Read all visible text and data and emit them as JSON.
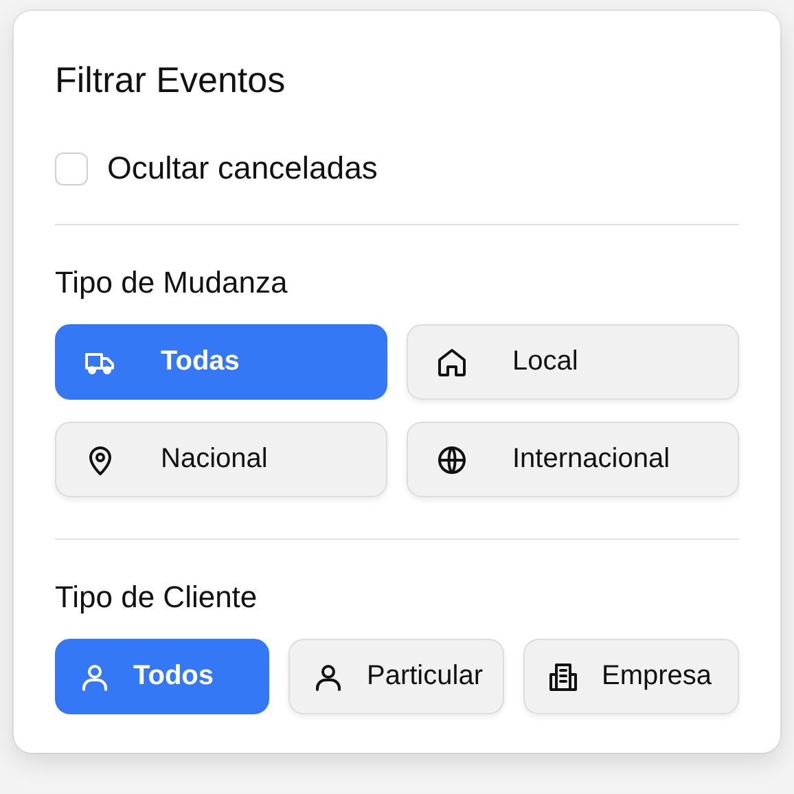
{
  "panel": {
    "title": "Filtrar Eventos",
    "hide_cancelled": {
      "label": "Ocultar canceladas",
      "checked": false
    },
    "sections": [
      {
        "title": "Tipo de Mudanza",
        "options": [
          {
            "label": "Todas",
            "kind": "truck",
            "selected": true
          },
          {
            "label": "Local",
            "kind": "house",
            "selected": false
          },
          {
            "label": "Nacional",
            "kind": "pin",
            "selected": false
          },
          {
            "label": "Internacional",
            "kind": "globe",
            "selected": false
          }
        ]
      },
      {
        "title": "Tipo de Cliente",
        "options": [
          {
            "label": "Todos",
            "kind": "person",
            "selected": true
          },
          {
            "label": "Particular",
            "kind": "person",
            "selected": false
          },
          {
            "label": "Empresa",
            "kind": "building",
            "selected": false
          }
        ]
      }
    ]
  }
}
